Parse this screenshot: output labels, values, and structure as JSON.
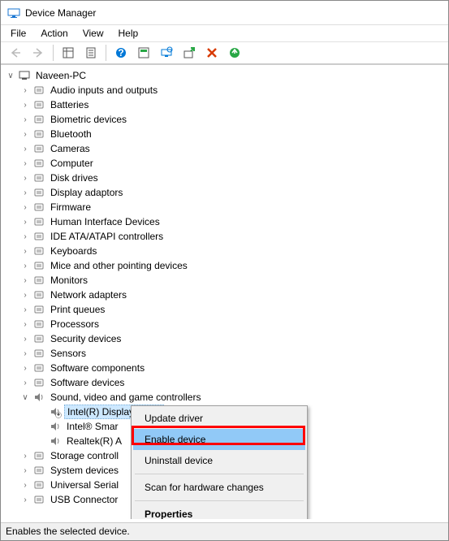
{
  "window": {
    "title": "Device Manager"
  },
  "menubar": {
    "file": "File",
    "action": "Action",
    "view": "View",
    "help": "Help"
  },
  "tree": {
    "root": "Naveen-PC",
    "categories": [
      "Audio inputs and outputs",
      "Batteries",
      "Biometric devices",
      "Bluetooth",
      "Cameras",
      "Computer",
      "Disk drives",
      "Display adaptors",
      "Firmware",
      "Human Interface Devices",
      "IDE ATA/ATAPI controllers",
      "Keyboards",
      "Mice and other pointing devices",
      "Monitors",
      "Network adapters",
      "Print queues",
      "Processors",
      "Security devices",
      "Sensors",
      "Software components",
      "Software devices"
    ],
    "sound_category": "Sound, video and game controllers",
    "sound_devices": [
      "Intel(R) Display Audio",
      "Intel® Smar",
      "Realtek(R) A"
    ],
    "tail_categories": [
      "Storage controll",
      "System devices",
      "Universal Serial",
      "USB Connector"
    ]
  },
  "context_menu": {
    "update": "Update driver",
    "enable": "Enable device",
    "uninstall": "Uninstall device",
    "scan": "Scan for hardware changes",
    "properties": "Properties"
  },
  "statusbar": {
    "text": "Enables the selected device."
  }
}
